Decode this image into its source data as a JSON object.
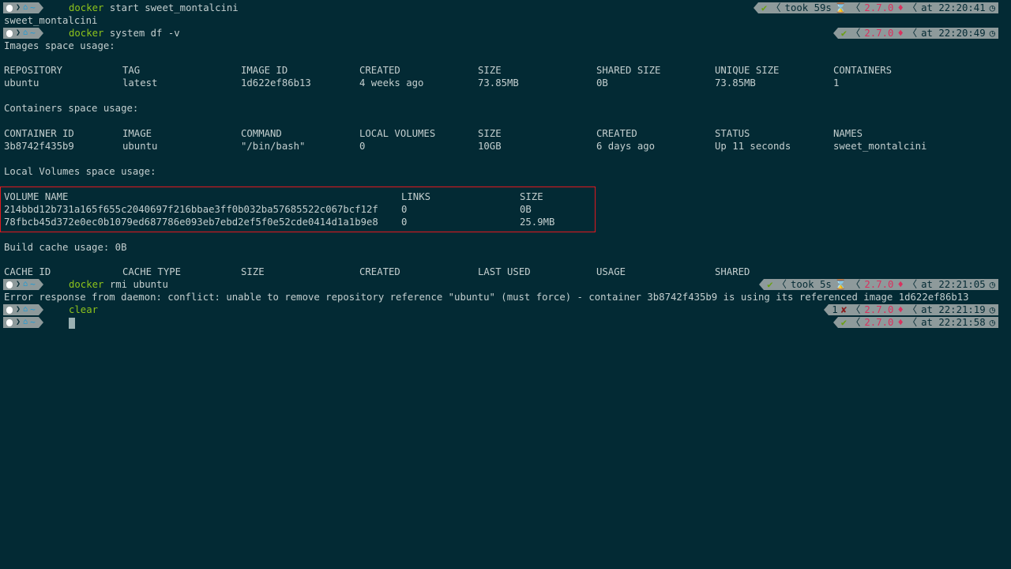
{
  "theme": {
    "background": "#032a34",
    "text": "#c4cfcf",
    "command": "#8ec31b",
    "segment_bg": "#8e9a9b",
    "ok": "#6aa012",
    "error": "#8a1d1d",
    "ruby": "#d9315e",
    "home": "#1a9bd7",
    "highlight_border": "#e1181e"
  },
  "prompt": {
    "apple_icon": "apple-icon",
    "home_icon": "home-icon",
    "dir": "~"
  },
  "lines": {
    "cmd1": {
      "command": "docker",
      "args": " start sweet_montalcini"
    },
    "rp1": {
      "status": "✔",
      "took": "took 59s",
      "took_icon": "hourglass-icon",
      "ruby_version": "2.7.0",
      "at": "at 22:20:41"
    },
    "out1": "sweet_montalcini",
    "cmd2": {
      "command": "docker",
      "args": " system df -v"
    },
    "rp2": {
      "status": "✔",
      "ruby_version": "2.7.0",
      "at": "at 22:20:49"
    },
    "images_header": "Images space usage:",
    "containers_header": "Containers space usage:",
    "volumes_header": "Local Volumes space usage:",
    "build_cache": "Build cache usage: 0B",
    "cmd3": {
      "command": "docker",
      "args": " rmi ubuntu"
    },
    "rp3": {
      "status": "✔",
      "took": "took 5s",
      "ruby_version": "2.7.0",
      "at": "at 22:21:05"
    },
    "error": "Error response from daemon: conflict: unable to remove repository reference \"ubuntu\" (must force) - container 3b8742f435b9 is using its referenced image 1d622ef86b13",
    "cmd4": {
      "command": "clear"
    },
    "rp4": {
      "exit_code": "1",
      "status": "✘",
      "ruby_version": "2.7.0",
      "at": "at 22:21:19"
    },
    "rp5": {
      "status": "✔",
      "ruby_version": "2.7.0",
      "at": "at 22:21:58"
    }
  },
  "images_table": {
    "headers": [
      "REPOSITORY",
      "TAG",
      "IMAGE ID",
      "CREATED",
      "SIZE",
      "SHARED SIZE",
      "UNIQUE SIZE",
      "CONTAINERS"
    ],
    "rows": [
      [
        "ubuntu",
        "latest",
        "1d622ef86b13",
        "4 weeks ago",
        "73.85MB",
        "0B",
        "73.85MB",
        "1"
      ]
    ]
  },
  "containers_table": {
    "headers": [
      "CONTAINER ID",
      "IMAGE",
      "COMMAND",
      "LOCAL VOLUMES",
      "SIZE",
      "CREATED",
      "STATUS",
      "NAMES"
    ],
    "rows": [
      [
        "3b8742f435b9",
        "ubuntu",
        "\"/bin/bash\"",
        "0",
        "10GB",
        "6 days ago",
        "Up 11 seconds",
        "sweet_montalcini"
      ]
    ]
  },
  "volumes_table": {
    "headers": [
      "VOLUME NAME",
      "LINKS",
      "SIZE"
    ],
    "rows": [
      [
        "214bbd12b731a165f655c2040697f216bbae3ff0b032ba57685522c067bcf12f",
        "0",
        "0B"
      ],
      [
        "78fbcb45d372e0ec0b1079ed687786e093eb7ebd2ef5f0e52cde0414d1a1b9e8",
        "0",
        "25.9MB"
      ]
    ]
  },
  "cache_table": {
    "headers": [
      "CACHE ID",
      "CACHE TYPE",
      "SIZE",
      "CREATED",
      "LAST USED",
      "USAGE",
      "SHARED"
    ]
  }
}
